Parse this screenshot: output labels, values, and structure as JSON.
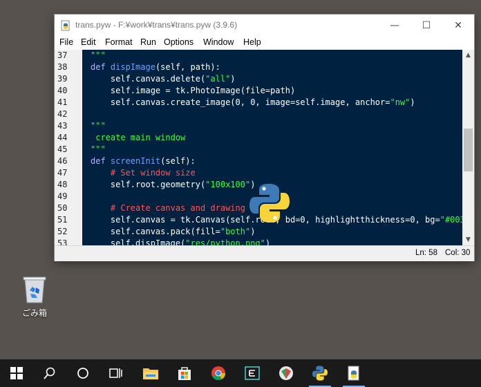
{
  "window": {
    "title": "trans.pyw - F:¥work¥trans¥trans.pyw (3.9.6)",
    "minimize_glyph": "—",
    "maximize_glyph": "☐",
    "close_glyph": "✕"
  },
  "menu": [
    "File",
    "Edit",
    "Format",
    "Run",
    "Options",
    "Window",
    "Help"
  ],
  "editor": {
    "line_numbers": [
      "37",
      "38",
      "39",
      "40",
      "41",
      "42",
      "43",
      "44",
      "45",
      "46",
      "47",
      "48",
      "49",
      "50",
      "51",
      "52",
      "53"
    ],
    "lines": [
      [
        {
          "t": "\"\"\"",
          "c": "st"
        }
      ],
      [
        {
          "t": "def ",
          "c": "kw"
        },
        {
          "t": "dispImage",
          "c": "fn"
        },
        {
          "t": "(self, path):",
          "c": ""
        }
      ],
      [
        {
          "t": "    self.canvas.delete(",
          "c": ""
        },
        {
          "t": "\"all\"",
          "c": "st"
        },
        {
          "t": ")",
          "c": ""
        }
      ],
      [
        {
          "t": "    self.image = tk.PhotoImage(file=path)",
          "c": ""
        }
      ],
      [
        {
          "t": "    self.canvas.create_image(0, 0, image=self.image, anchor=",
          "c": ""
        },
        {
          "t": "\"nw\"",
          "c": "st"
        },
        {
          "t": ")",
          "c": ""
        }
      ],
      [
        {
          "t": "",
          "c": ""
        }
      ],
      [
        {
          "t": "\"\"\"",
          "c": "st"
        }
      ],
      [
        {
          "t": " create main window",
          "c": "st"
        }
      ],
      [
        {
          "t": "\"\"\"",
          "c": "st"
        }
      ],
      [
        {
          "t": "def ",
          "c": "kw"
        },
        {
          "t": "screenInit",
          "c": "fn"
        },
        {
          "t": "(self):",
          "c": ""
        }
      ],
      [
        {
          "t": "    # Set window size",
          "c": "cm"
        }
      ],
      [
        {
          "t": "    self.root.geometry(",
          "c": ""
        },
        {
          "t": "\"100x100\"",
          "c": "st"
        },
        {
          "t": ")",
          "c": ""
        }
      ],
      [
        {
          "t": "",
          "c": ""
        }
      ],
      [
        {
          "t": "    # Create canvas and drawing i",
          "c": "cm"
        }
      ],
      [
        {
          "t": "    self.canvas = tk.Canvas(self.root, bd=0, highlightthickness=0, bg=",
          "c": ""
        },
        {
          "t": "\"#0033",
          "c": "st"
        }
      ],
      [
        {
          "t": "    self.canvas.pack(fill=",
          "c": ""
        },
        {
          "t": "\"both\"",
          "c": "st"
        },
        {
          "t": ")",
          "c": ""
        }
      ],
      [
        {
          "t": "    self.dispImage(",
          "c": ""
        },
        {
          "t": "\"res/python.png\"",
          "c": "st"
        },
        {
          "t": ")",
          "c": ""
        }
      ]
    ]
  },
  "status": {
    "line": "Ln: 58",
    "col": "Col: 30"
  },
  "desktop": {
    "recycle_bin_label": "ごみ箱"
  },
  "taskbar": {
    "items": [
      "windows-start-icon",
      "search-icon",
      "cortana-icon",
      "task-view-icon",
      "file-explorer-icon",
      "store-icon",
      "chrome-icon",
      "editor-app-icon",
      "gem-app-icon",
      "python-icon",
      "idle-icon"
    ]
  },
  "colors": {
    "editor_bg": "#002240",
    "string": "#39ff39",
    "keyword": "#b4b4ff",
    "function": "#6ea0ff",
    "comment": "#ff5555",
    "desktop": "#57524e",
    "taskbar": "#1a1a1a"
  }
}
